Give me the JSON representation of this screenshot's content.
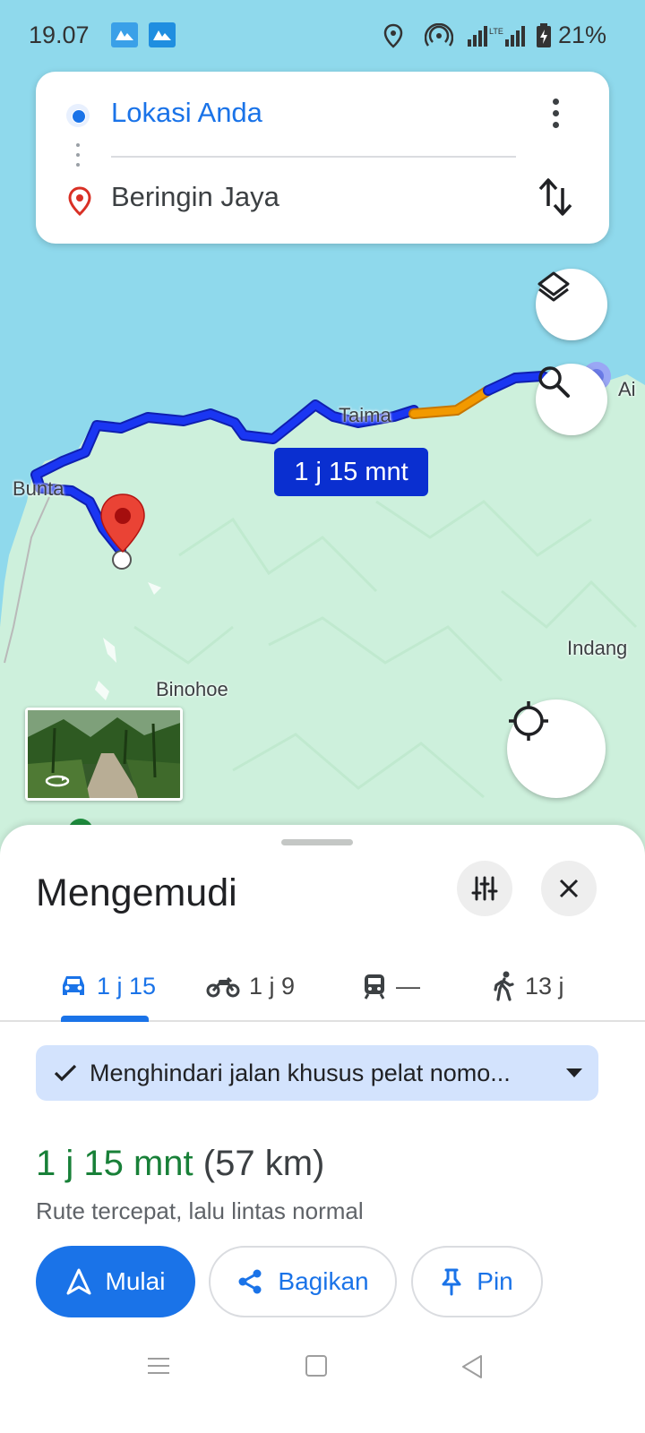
{
  "status_bar": {
    "time": "19.07",
    "battery": "21%",
    "icons": [
      "app-icon",
      "app-icon",
      "location-icon",
      "hotspot-icon",
      "signal-icon",
      "battery-charging-icon"
    ]
  },
  "directions": {
    "origin": "Lokasi Anda",
    "destination": "Beringin Jaya"
  },
  "map": {
    "eta_chip": "1 j 15 mnt",
    "labels": {
      "taima": "Taima",
      "bunta": "Bunta",
      "binohoe": "Binohoe",
      "indang": "Indang",
      "edge": "Ai"
    },
    "route_colors": {
      "route": "#1a36f2",
      "traffic": "#f29900"
    }
  },
  "sheet": {
    "title": "Mengemudi",
    "modes": [
      {
        "icon": "car-icon",
        "label": "1 j 15"
      },
      {
        "icon": "motorcycle-icon",
        "label": "1 j 9"
      },
      {
        "icon": "transit-icon",
        "label": "—"
      },
      {
        "icon": "walk-icon",
        "label": "13 j"
      }
    ],
    "avoid_text": "Menghindari jalan khusus pelat nomo...",
    "route_duration": "1 j 15 mnt",
    "route_distance": "(57 km)",
    "route_sub": "Rute tercepat, lalu lintas normal",
    "buttons": {
      "start": "Mulai",
      "share": "Bagikan",
      "pin": "Pin"
    }
  },
  "colors": {
    "accent": "#1a73e8",
    "duration_green": "#188038",
    "water": "#8fd9ec",
    "land": "#cdf0dc"
  }
}
